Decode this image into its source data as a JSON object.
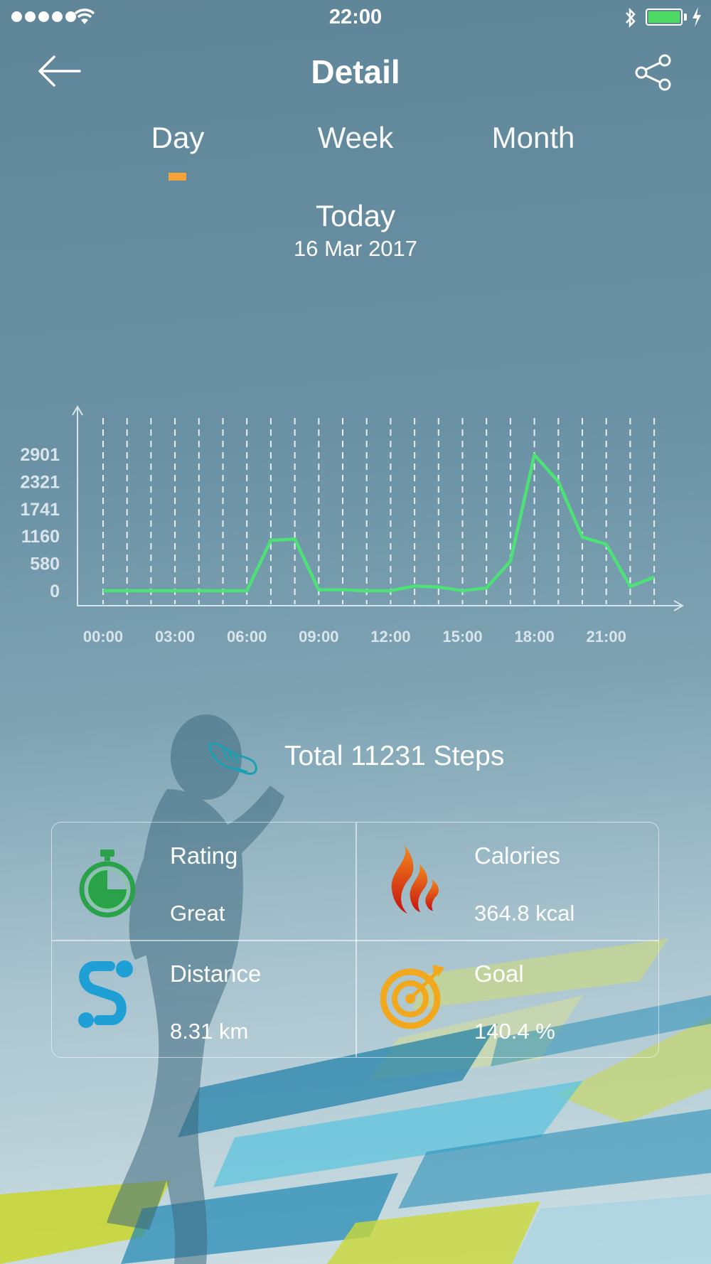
{
  "status": {
    "time": "22:00",
    "battery_color": "#4cd964"
  },
  "nav": {
    "title": "Detail",
    "back_icon": "arrow-left-icon",
    "share_icon": "share-icon"
  },
  "tabs": [
    {
      "label": "Day",
      "active": true
    },
    {
      "label": "Week",
      "active": false
    },
    {
      "label": "Month",
      "active": false
    }
  ],
  "tab_indicator_color": "#f6a33a",
  "date": {
    "title": "Today",
    "subtitle": "16 Mar 2017"
  },
  "chart_data": {
    "type": "line",
    "y_ticks": [
      "0",
      "580",
      "1160",
      "1741",
      "2321",
      "2901"
    ],
    "ylim": [
      0,
      2901
    ],
    "x_ticks": [
      "00:00",
      "03:00",
      "06:00",
      "09:00",
      "12:00",
      "15:00",
      "18:00",
      "21:00"
    ],
    "x_hours": [
      0,
      1,
      2,
      3,
      4,
      5,
      6,
      7,
      8,
      9,
      10,
      11,
      12,
      13,
      14,
      15,
      16,
      17,
      18,
      19,
      20,
      21,
      22,
      23
    ],
    "values": [
      0,
      0,
      0,
      0,
      0,
      0,
      0,
      1070,
      1100,
      20,
      20,
      0,
      0,
      100,
      80,
      0,
      60,
      630,
      2890,
      2320,
      1140,
      990,
      90,
      290
    ],
    "line_color": "#4de276",
    "grid": "vertical-dashed"
  },
  "total": {
    "text": "Total 11231 Steps",
    "icon": "shoe-icon"
  },
  "stats": {
    "rating": {
      "label": "Rating",
      "value": "Great",
      "icon": "stopwatch-icon"
    },
    "calories": {
      "label": "Calories",
      "value": "364.8 kcal",
      "icon": "flame-icon"
    },
    "distance": {
      "label": "Distance",
      "value": "8.31 km",
      "icon": "route-icon"
    },
    "goal": {
      "label": "Goal",
      "value": "140.4 %",
      "icon": "target-icon"
    }
  }
}
